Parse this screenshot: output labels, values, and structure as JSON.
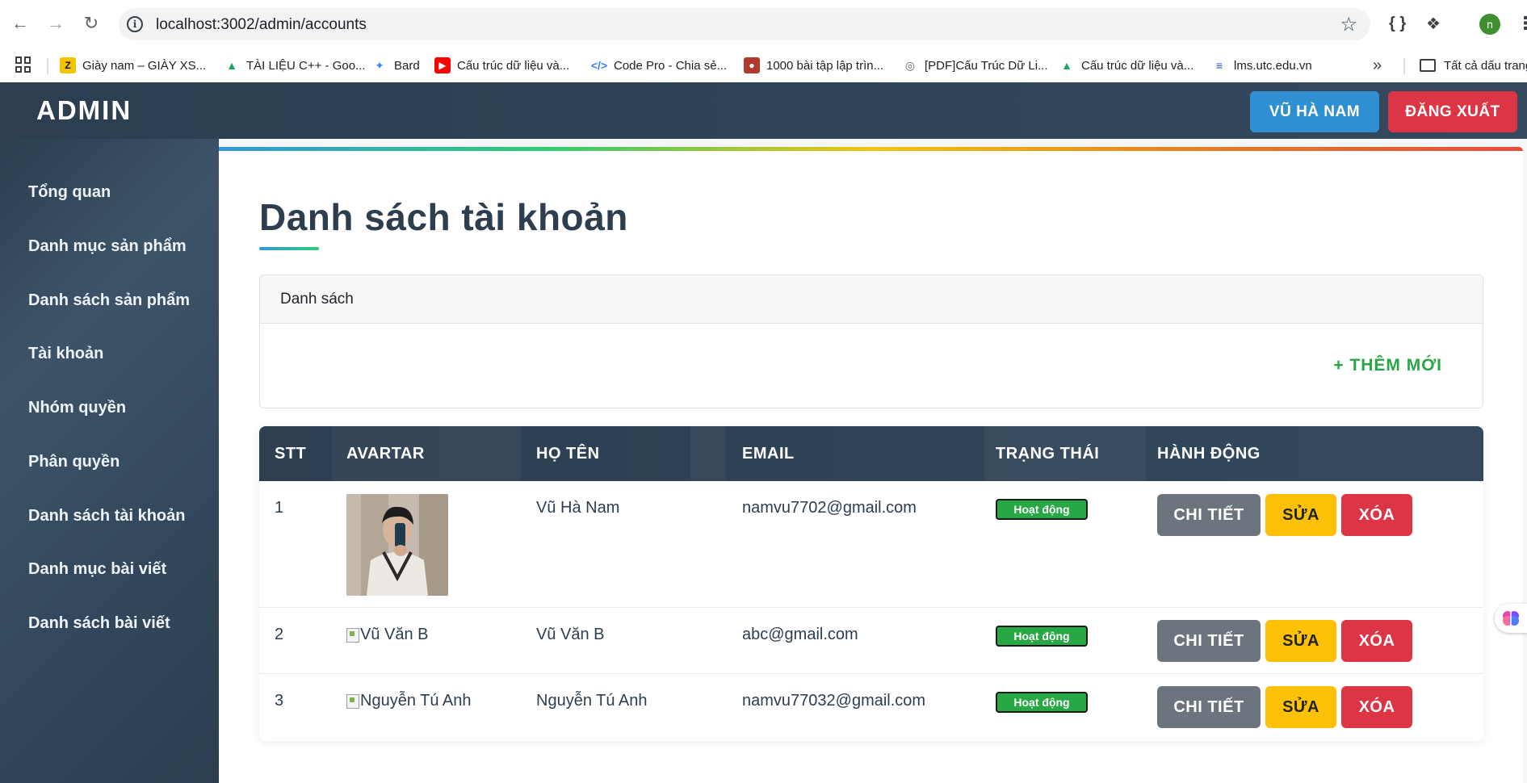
{
  "browser": {
    "url": "localhost:3002/admin/accounts",
    "bookmarks": [
      {
        "label": "Giày nam – GIÀY XS...",
        "icon": "z-logo-icon",
        "color": "#f5c400"
      },
      {
        "label": "TÀI LIỆU C++ - Goo...",
        "icon": "google-drive-icon",
        "color": "#1fa463"
      },
      {
        "label": "Bard",
        "icon": "sparkle-icon",
        "color": "#4285f4"
      },
      {
        "label": "Cấu trúc dữ liệu và...",
        "icon": "youtube-icon",
        "color": "#ff0000"
      },
      {
        "label": "Code Pro - Chia sẻ...",
        "icon": "code-icon",
        "color": "#3b82f6"
      },
      {
        "label": "1000 bài tập lập trìn...",
        "icon": "person-icon",
        "color": "#b03a2e"
      },
      {
        "label": "[PDF]Cấu Trúc Dữ Li...",
        "icon": "globe-icon",
        "color": "#5f6368"
      },
      {
        "label": "Cấu trúc dữ liệu và...",
        "icon": "google-drive-icon",
        "color": "#1fa463"
      },
      {
        "label": "lms.utc.edu.vn",
        "icon": "lms-logo-icon",
        "color": "#1a56db"
      }
    ],
    "bookmarks_folder": "Tất cả dấu trang",
    "profile_initial": "n"
  },
  "header": {
    "brand": "ADMIN",
    "user_button": "VŨ HÀ NAM",
    "logout_button": "ĐĂNG XUẤT"
  },
  "sidebar": {
    "items": [
      {
        "label": "Tổng quan"
      },
      {
        "label": "Danh mục sản phẩm"
      },
      {
        "label": "Danh sách sản phẩm"
      },
      {
        "label": "Tài khoản"
      },
      {
        "label": "Nhóm quyền"
      },
      {
        "label": "Phân quyền"
      },
      {
        "label": "Danh sách tài khoản"
      },
      {
        "label": "Danh mục bài viết"
      },
      {
        "label": "Danh sách bài viết"
      }
    ]
  },
  "main": {
    "title": "Danh sách tài khoản",
    "panel_title": "Danh sách",
    "add_button": "+ THÊM MỚI",
    "table": {
      "columns": [
        "STT",
        "AVARTAR",
        "HỌ TÊN",
        "EMAIL",
        "TRẠNG THÁI",
        "HÀNH ĐỘNG"
      ],
      "rows": [
        {
          "stt": "1",
          "avatar_alt": "",
          "name": "Vũ Hà Nam",
          "email": "namvu7702@gmail.com",
          "status": "Hoạt động"
        },
        {
          "stt": "2",
          "avatar_alt": "Vũ Văn B",
          "name": "Vũ Văn B",
          "email": "abc@gmail.com",
          "status": "Hoạt động"
        },
        {
          "stt": "3",
          "avatar_alt": "Nguyễn Tú Anh",
          "name": "Nguyễn Tú Anh",
          "email": "namvu77032@gmail.com",
          "status": "Hoạt động"
        }
      ],
      "actions": {
        "detail": "CHI TIẾT",
        "edit": "SỬA",
        "delete": "XÓA"
      }
    }
  },
  "colors": {
    "header_bg": "#2c3e50",
    "user_button": "#2f8fd1",
    "logout_button": "#dc3545",
    "add_button_text": "#28a745",
    "status_badge": "#28a745",
    "detail_button": "#6c757d",
    "edit_button": "#ffc107",
    "delete_button": "#dc3545"
  }
}
